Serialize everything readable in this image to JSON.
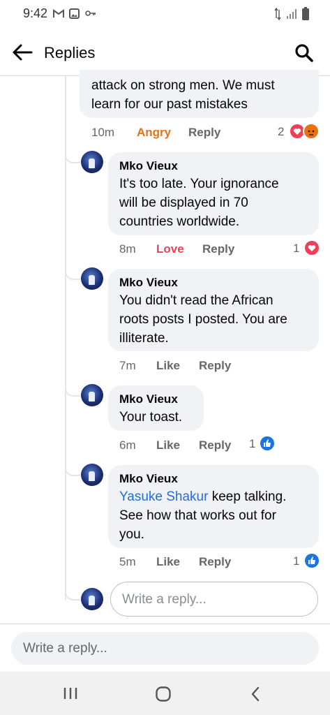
{
  "status": {
    "time": "9:42"
  },
  "header": {
    "title": "Replies"
  },
  "parent_comment": {
    "text_line1": "attack on strong men. We must",
    "text_line2": "learn for our past mistakes",
    "time": "10m",
    "reaction": "Angry",
    "reply": "Reply",
    "reaction_count": "2",
    "reaction_color": "#e9710f"
  },
  "replies": [
    {
      "author": "Mko Vieux",
      "lines": [
        "It's too late. Your ignorance",
        "will be displayed in 70",
        "countries worldwide."
      ],
      "time": "8m",
      "reaction": "Love",
      "reply": "Reply",
      "count": "1",
      "reaction_color": "#f33e58"
    },
    {
      "author": "Mko Vieux",
      "lines": [
        "You didn't read the African",
        "roots posts I posted. You are",
        "illiterate."
      ],
      "time": "7m",
      "reaction": "Like",
      "reply": "Reply",
      "count": ""
    },
    {
      "author": "Mko Vieux",
      "lines": [
        "Your toast."
      ],
      "time": "6m",
      "reaction": "Like",
      "reply": "Reply",
      "count": "1"
    },
    {
      "author": "Mko Vieux",
      "mention": "Yasuke Shakur",
      "line1_rest": " keep talking.",
      "lines": [
        "See how that works out for",
        "you."
      ],
      "time": "5m",
      "reaction": "Like",
      "reply": "Reply",
      "count": "1"
    }
  ],
  "composer": {
    "inline_placeholder": "Write a reply...",
    "bottom_placeholder": "Write a reply..."
  },
  "colors": {
    "love": "#f33e58",
    "like": "#1b74e4",
    "angry": "#e9710f",
    "mention": "#216fdb"
  }
}
